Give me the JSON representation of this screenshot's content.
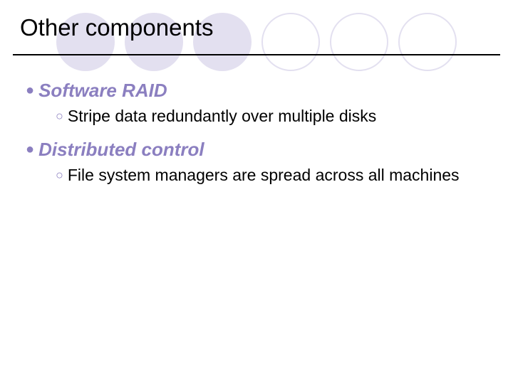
{
  "title": "Other components",
  "bullets": [
    {
      "label": "Software RAID",
      "sub": "Stripe data redundantly over multiple disks"
    },
    {
      "label": "Distributed control",
      "sub": "File system managers are spread across all machines"
    }
  ]
}
